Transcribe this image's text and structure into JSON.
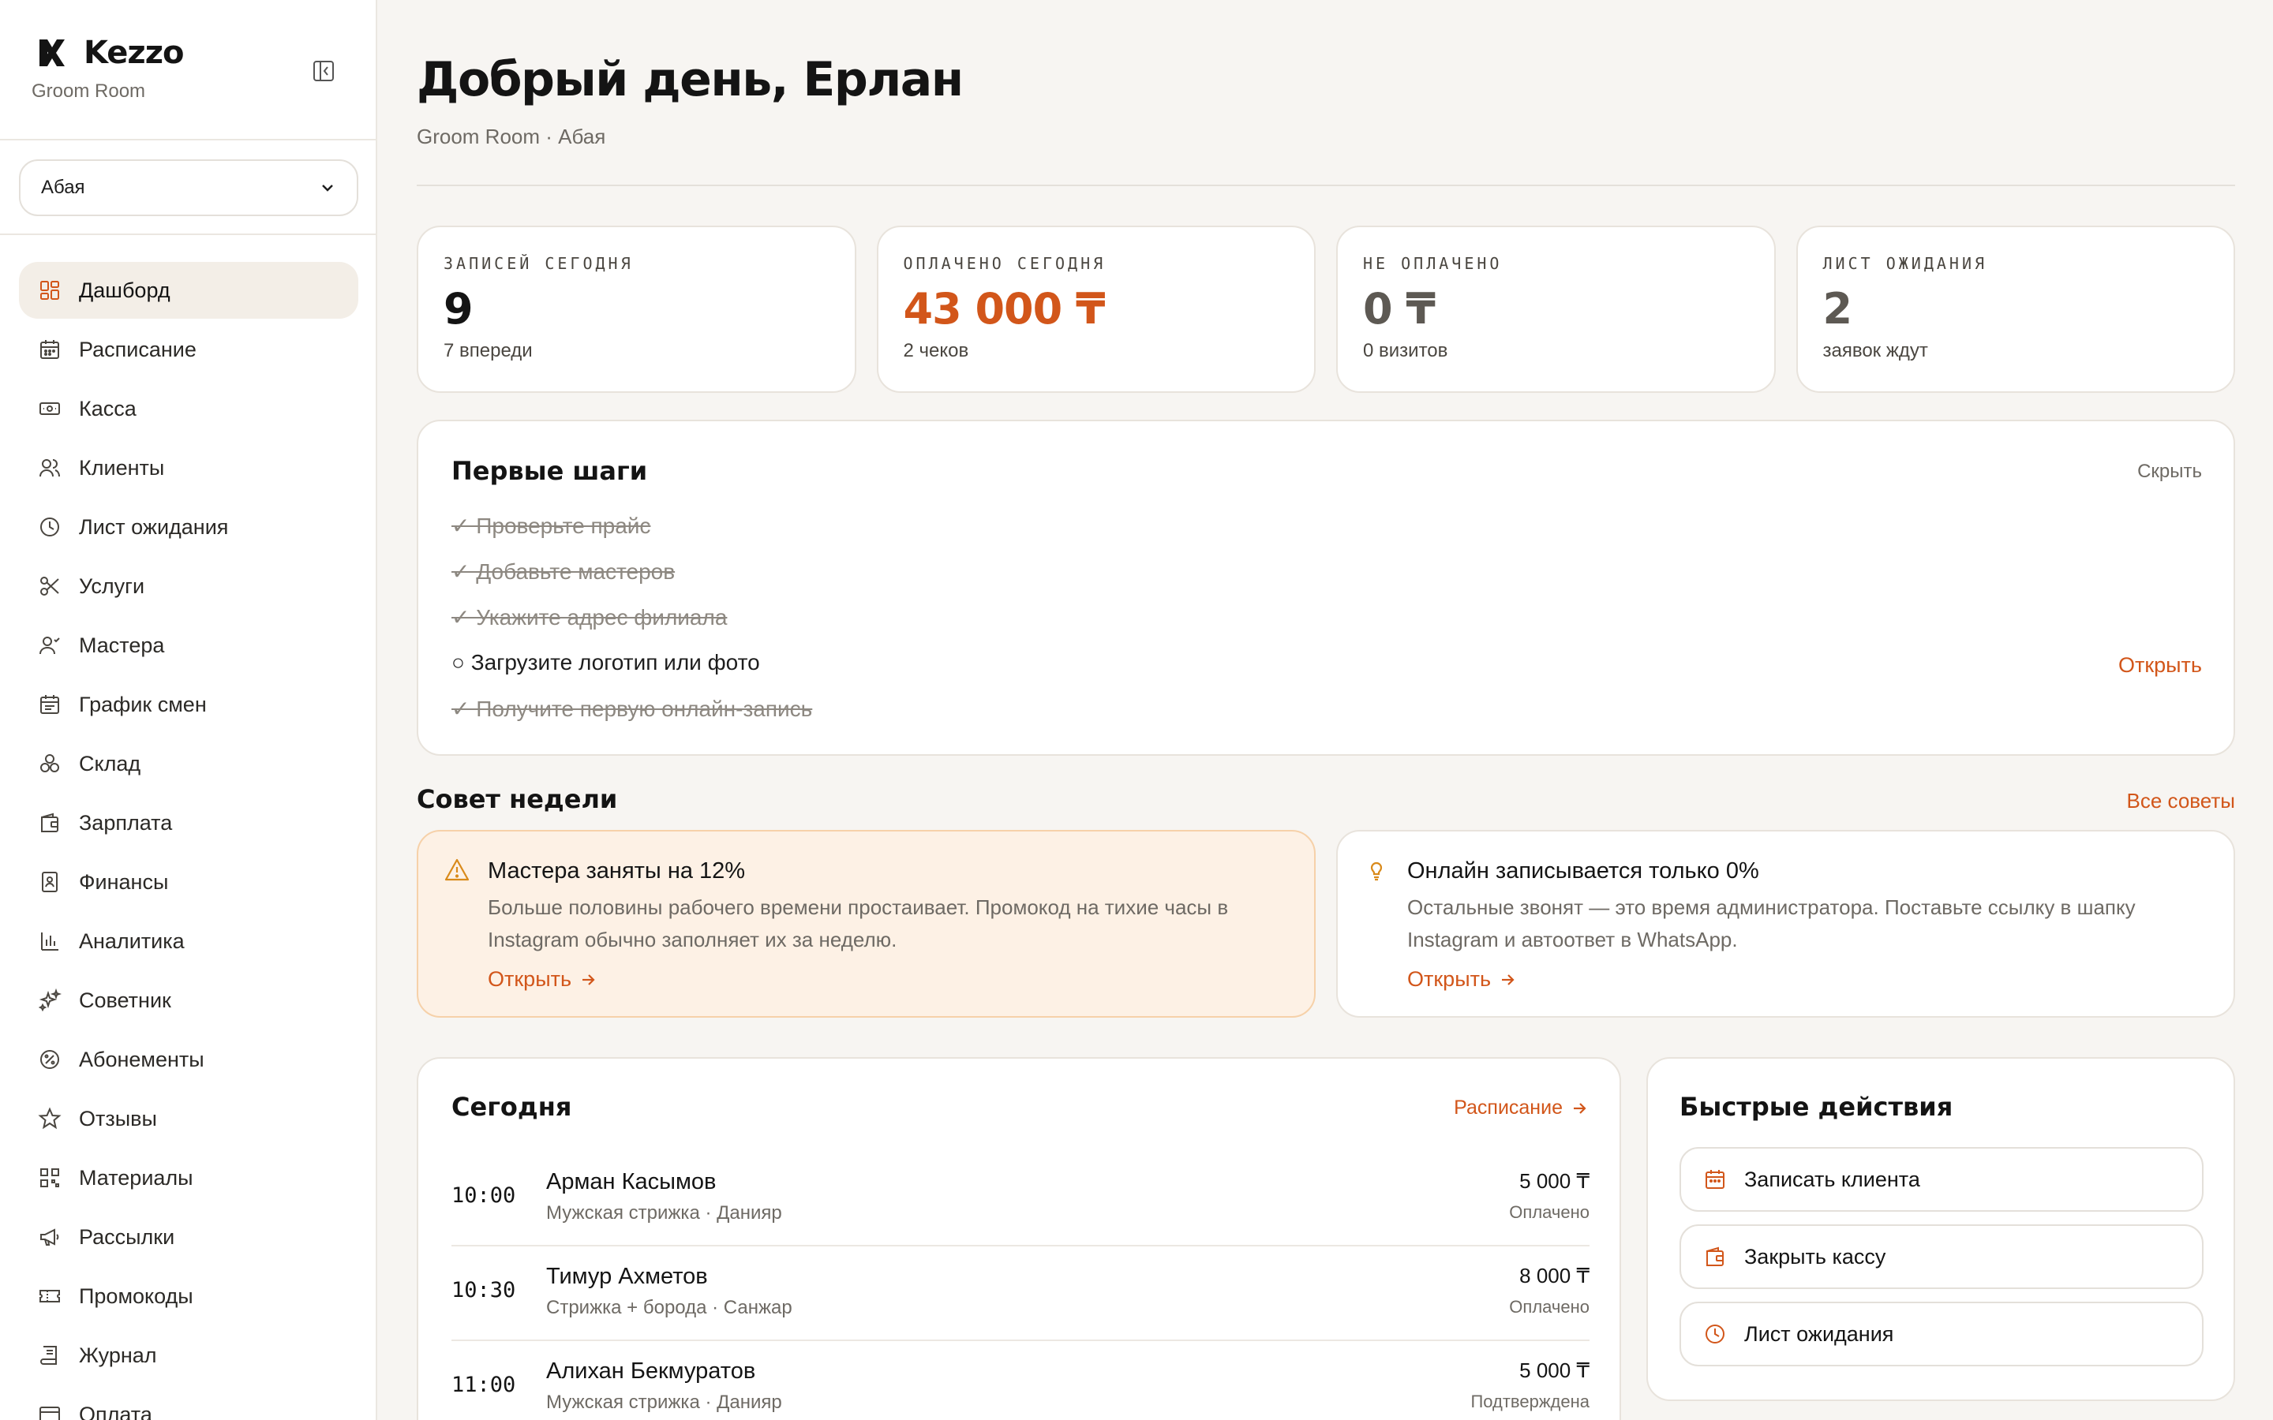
{
  "brand": {
    "name": "Kezzo",
    "subtitle": "Groom Room"
  },
  "branch": {
    "selected": "Абая"
  },
  "sidebar": {
    "items": [
      {
        "label": "Дашборд",
        "icon": "dashboard-icon",
        "active": true
      },
      {
        "label": "Расписание",
        "icon": "calendar-icon"
      },
      {
        "label": "Касса",
        "icon": "cash-icon"
      },
      {
        "label": "Клиенты",
        "icon": "users-icon"
      },
      {
        "label": "Лист ожидания",
        "icon": "clock-icon"
      },
      {
        "label": "Услуги",
        "icon": "scissors-icon"
      },
      {
        "label": "Мастера",
        "icon": "masters-icon"
      },
      {
        "label": "График смен",
        "icon": "schedule-icon"
      },
      {
        "label": "Склад",
        "icon": "boxes-icon"
      },
      {
        "label": "Зарплата",
        "icon": "wallet-icon"
      },
      {
        "label": "Финансы",
        "icon": "finance-icon"
      },
      {
        "label": "Аналитика",
        "icon": "chart-icon"
      },
      {
        "label": "Советник",
        "icon": "sparkles-icon"
      },
      {
        "label": "Абонементы",
        "icon": "subscription-icon"
      },
      {
        "label": "Отзывы",
        "icon": "star-icon"
      },
      {
        "label": "Материалы",
        "icon": "qr-icon"
      },
      {
        "label": "Рассылки",
        "icon": "megaphone-icon"
      },
      {
        "label": "Промокоды",
        "icon": "ticket-icon"
      },
      {
        "label": "Журнал",
        "icon": "journal-icon"
      },
      {
        "label": "Оплата",
        "icon": "payment-icon"
      }
    ]
  },
  "header": {
    "greeting": "Добрый день, Ерлан",
    "subtitle": "Groom Room · Абая"
  },
  "stats": [
    {
      "label": "ЗАПИСЕЙ СЕГОДНЯ",
      "value": "9",
      "note": "7 впереди"
    },
    {
      "label": "ОПЛАЧЕНО СЕГОДНЯ",
      "value": "43 000 ₸",
      "note": "2 чеков"
    },
    {
      "label": "НЕ ОПЛАЧЕНО",
      "value": "0 ₸",
      "note": "0 визитов"
    },
    {
      "label": "ЛИСТ ОЖИДАНИЯ",
      "value": "2",
      "note": "заявок ждут"
    }
  ],
  "steps": {
    "title": "Первые шаги",
    "hide_label": "Скрыть",
    "open_label": "Открыть",
    "items": [
      {
        "text": "✓ Проверьте прайс",
        "done": true
      },
      {
        "text": "✓ Добавьте мастеров",
        "done": true
      },
      {
        "text": "✓ Укажите адрес филиала",
        "done": true
      },
      {
        "text": "○ Загрузите логотип или фото",
        "done": false
      },
      {
        "text": "✓ Получите первую онлайн-запись",
        "done": true
      }
    ]
  },
  "tips": {
    "title": "Совет недели",
    "all_label": "Все советы",
    "items": [
      {
        "title": "Мастера заняты на 12%",
        "body": "Больше половины рабочего времени простаивает. Промокод на тихие часы в Instagram обычно заполняет их за неделю.",
        "link": "Открыть",
        "icon": "warning-icon"
      },
      {
        "title": "Онлайн записывается только 0%",
        "body": "Остальные звонят — это время администратора. Поставьте ссылку в шапку Instagram и автоответ в WhatsApp.",
        "link": "Открыть",
        "icon": "lightbulb-icon"
      }
    ]
  },
  "today": {
    "title": "Сегодня",
    "link": "Расписание",
    "appointments": [
      {
        "time": "10:00",
        "name": "Арман Касымов",
        "service": "Мужская стрижка · Данияр",
        "price": "5 000 ₸",
        "status": "Оплачено"
      },
      {
        "time": "10:30",
        "name": "Тимур Ахметов",
        "service": "Стрижка + борода · Санжар",
        "price": "8 000 ₸",
        "status": "Оплачено"
      },
      {
        "time": "11:00",
        "name": "Алихан Бекмуратов",
        "service": "Мужская стрижка · Данияр",
        "price": "5 000 ₸",
        "status": "Подтверждена"
      }
    ]
  },
  "quick": {
    "title": "Быстрые действия",
    "actions": [
      {
        "label": "Записать клиента",
        "icon": "calendar-icon"
      },
      {
        "label": "Закрыть кассу",
        "icon": "wallet-icon"
      },
      {
        "label": "Лист ожидания",
        "icon": "clock-icon"
      }
    ]
  },
  "colors": {
    "accent": "#d2561a",
    "background": "#f7f5f2",
    "active_nav": "#f3eee7"
  }
}
